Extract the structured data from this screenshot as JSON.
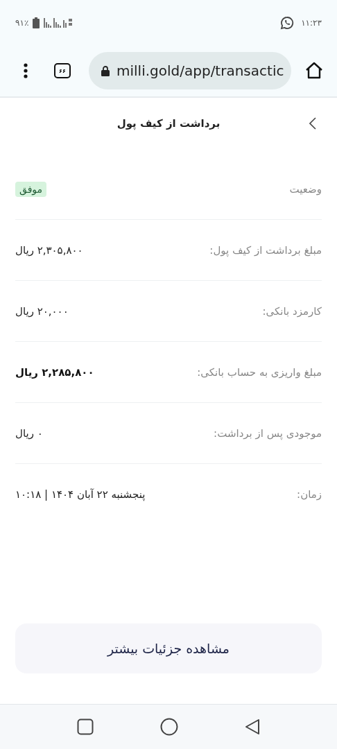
{
  "status_bar": {
    "time": "۱۱:۲۳",
    "battery": "۹۱٪"
  },
  "browser": {
    "url": "milli.gold/app/transactic",
    "tab_count": "۶۶"
  },
  "page": {
    "title": "برداشت از کیف پول"
  },
  "details": [
    {
      "kind": "badge",
      "label": "وضعیت",
      "value": "موفق"
    },
    {
      "kind": "text",
      "label": "مبلغ برداشت از کیف پول:",
      "value": "۲,۳۰۵,۸۰۰ ریال"
    },
    {
      "kind": "text",
      "label": "کارمزد بانکی:",
      "value": "۲۰,۰۰۰ ریال"
    },
    {
      "kind": "strong",
      "label": "مبلغ واریزی به حساب بانکی:",
      "value": "۲,۲۸۵,۸۰۰ ریال"
    },
    {
      "kind": "text",
      "label": "موجودی پس از برداشت:",
      "value": "۰ ریال"
    },
    {
      "kind": "text",
      "label": "زمان:",
      "value": "پنجشنبه ۲۲ آبان ۱۴۰۴ | ۱۰:۱۸"
    }
  ],
  "more_button": "مشاهده جزئیات بیشتر"
}
